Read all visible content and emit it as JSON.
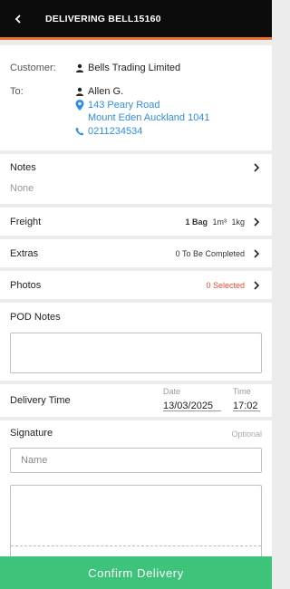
{
  "header": {
    "title": "DELIVERING BELL15160",
    "back_icon": "back-arrow-icon"
  },
  "customer": {
    "label": "Customer:",
    "name": "Bells Trading Limited",
    "icon": "person-icon"
  },
  "recipient": {
    "label": "To:",
    "name": "Allen G.",
    "address_line1": "143 Peary Road",
    "address_line2": "Mount Eden Auckland 1041",
    "phone": "0211234534",
    "icons": {
      "person": "person-icon",
      "location": "location-pin-icon",
      "phone": "phone-icon"
    }
  },
  "notes": {
    "label": "Notes",
    "value": "None"
  },
  "freight": {
    "label": "Freight",
    "bag": "1 Bag",
    "volume": "1m³",
    "weight": "1kg"
  },
  "extras": {
    "label": "Extras",
    "value": "0 To Be Completed"
  },
  "photos": {
    "label": "Photos",
    "value": "0 Selected"
  },
  "pod_notes": {
    "label": "POD Notes",
    "value": ""
  },
  "delivery_time": {
    "label": "Delivery Time",
    "date_label": "Date",
    "date_value": "13/03/2025",
    "time_label": "Time",
    "time_value": "17:02"
  },
  "signature": {
    "label": "Signature",
    "optional_label": "Optional",
    "name_placeholder": "Name"
  },
  "footer": {
    "confirm_label": "Confirm Delivery"
  },
  "colors": {
    "accent": "#e8702a",
    "link": "#2f8ee3",
    "error": "#e74c3c",
    "success": "#3ec47a",
    "header_bg": "#0c0c0c"
  }
}
